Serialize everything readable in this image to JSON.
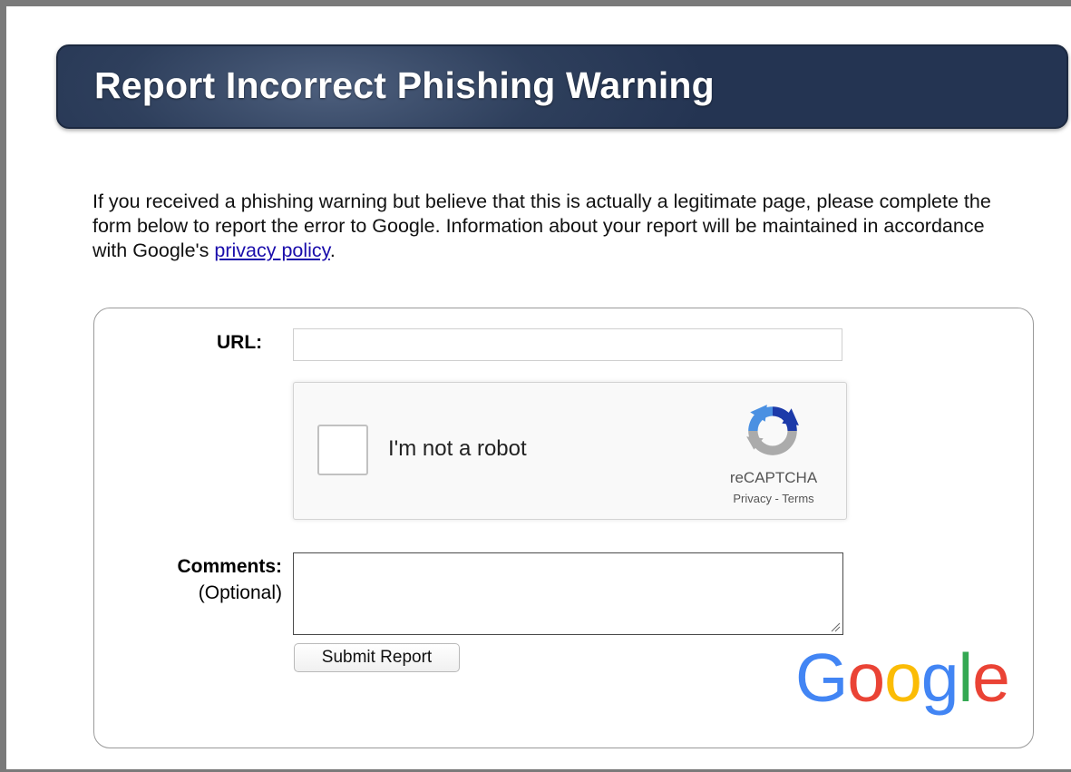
{
  "header": {
    "title": "Report Incorrect Phishing Warning"
  },
  "intro": {
    "text_before_link": "If you received a phishing warning but believe that this is actually a legitimate page, please complete the form below to report the error to Google. Information about your report will be maintained in accordance with Google's ",
    "link_text": "privacy policy",
    "text_after_link": "."
  },
  "form": {
    "url_label": "URL:",
    "url_value": "",
    "recaptcha": {
      "checkbox_label": "I'm not a robot",
      "brand": "reCAPTCHA",
      "links": "Privacy - Terms",
      "checked": false
    },
    "comments_label": "Comments:",
    "comments_optional": "(Optional)",
    "comments_value": "",
    "submit_label": "Submit Report"
  },
  "logo": {
    "letters": [
      "G",
      "o",
      "o",
      "g",
      "l",
      "e"
    ],
    "colors": [
      "#4285F4",
      "#EA4335",
      "#FBBC05",
      "#4285F4",
      "#34A853",
      "#EA4335"
    ]
  },
  "icons": [
    "recaptcha-logo-icon",
    "resize-grip-icon",
    "google-logo"
  ]
}
